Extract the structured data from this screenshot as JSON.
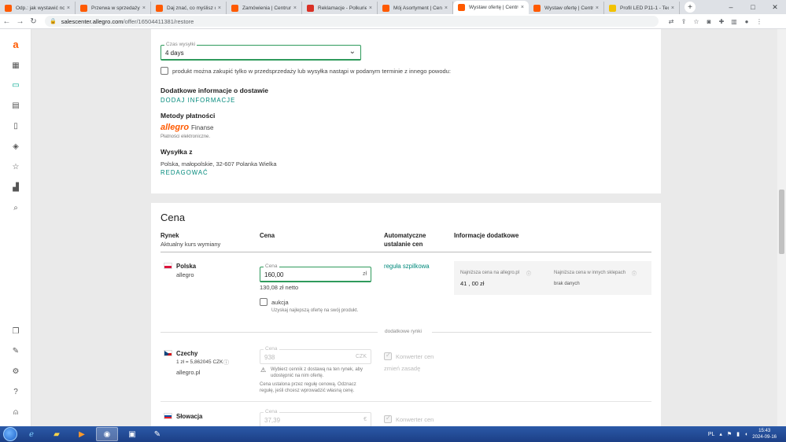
{
  "browser": {
    "tabs": [
      {
        "label": "Odp.: jak wystawić now",
        "color": "#ff5a00"
      },
      {
        "label": "Przerwa w sprzedaży |",
        "color": "#ff5a00"
      },
      {
        "label": "Daj znać, co myślisz o t",
        "color": "#ff5a00"
      },
      {
        "label": "Zamówienia | Centrum",
        "color": "#ff5a00"
      },
      {
        "label": "Reklamacje - Polkurier",
        "color": "#d93025"
      },
      {
        "label": "Mój Asortyment | Centr",
        "color": "#ff5a00"
      },
      {
        "label": "Wystaw ofertę | Centru",
        "color": "#ff5a00"
      },
      {
        "label": "Wystaw ofertę | Centru",
        "color": "#ff5a00"
      },
      {
        "label": "Profil LED P11-1 - Tech",
        "color": "#f2c200"
      }
    ],
    "active_tab": 6,
    "url_host": "salescenter.allegro.com",
    "url_path": "/offer/16504411381/restore"
  },
  "sidebar": {
    "logo": "a",
    "icons": [
      "dashboard-icon",
      "offers-icon",
      "orders-icon",
      "documents-icon",
      "tag-icon",
      "star-icon",
      "stats-icon",
      "search-icon",
      "messages-icon",
      "edit-icon",
      "settings-icon",
      "help-icon",
      "user-icon"
    ]
  },
  "delivery": {
    "shipping_time_label": "Czas wysyłki",
    "shipping_time_value": "4 days",
    "presale_text": "produkt można zakupić tylko w przedsprzedaży lub wysyłka nastąpi w podanym terminie z innego powodu:",
    "extra_info_title": "Dodatkowe informacje o dostawie",
    "extra_info_link": "DODAJ INFORMACJE",
    "payment_title": "Metody płatności",
    "payment_brand": "allegro",
    "payment_brand_suffix": "Finanse",
    "payment_sub": "Płatności elektroniczne.",
    "ship_from_title": "Wysyłka z",
    "ship_from_address": "Polska, małopolskie, 32-607 Polanka Wielka",
    "edit_link": "REDAGOWAĆ"
  },
  "price": {
    "section_title": "Cena",
    "headers": {
      "market": "Rynek",
      "market_sub": "Aktualny kurs wymiany",
      "price": "Cena",
      "auto": "Automatyczne",
      "auto_sub": "ustalanie cen",
      "info": "Informacje dodatkowe"
    },
    "poland": {
      "name": "Polska",
      "sub": "allegro",
      "price_label": "Cena",
      "price_value": "160,00",
      "currency": "zł",
      "net": "130,08 zł  netto",
      "auction_label": "aukcja",
      "auction_hint": "Uzyskaj najlepszą ofertę na swój produkt.",
      "rule_link": "reguła szpilkowa",
      "lowest_allegro_label": "Najniższa cena na allegro.pl",
      "lowest_allegro_value": "41 , 00  zł",
      "lowest_other_label": "Najniższa cena w innych sklepach",
      "lowest_other_value": "brak danych"
    },
    "additional_markets_label": "dodatkowe rynki",
    "czech": {
      "name": "Czechy",
      "rate": "1 zł = 5,862045 CZK",
      "sub": "allegro.pl",
      "price_label": "Cena",
      "price_value": "938",
      "currency": "CZK",
      "warning": "Wybierz cennik z dostawą na ten rynek, aby",
      "warning2": "udostępnić na nim ofertę.",
      "note": "Cena ustalona przez regułę cenową. Odznacz",
      "note2": "regułę, jeśli chcesz wprowadzić własną cenę.",
      "converter_label": "Konwerter cen",
      "change_rules": "zmień zasadę"
    },
    "slovakia": {
      "name": "Słowacja",
      "price_label": "Cena",
      "price_value": "37,39",
      "currency": "€",
      "converter_label": "Konwerter cen"
    }
  },
  "taskbar": {
    "lang": "PL",
    "time": "15:43",
    "date": "2024-09-16"
  }
}
